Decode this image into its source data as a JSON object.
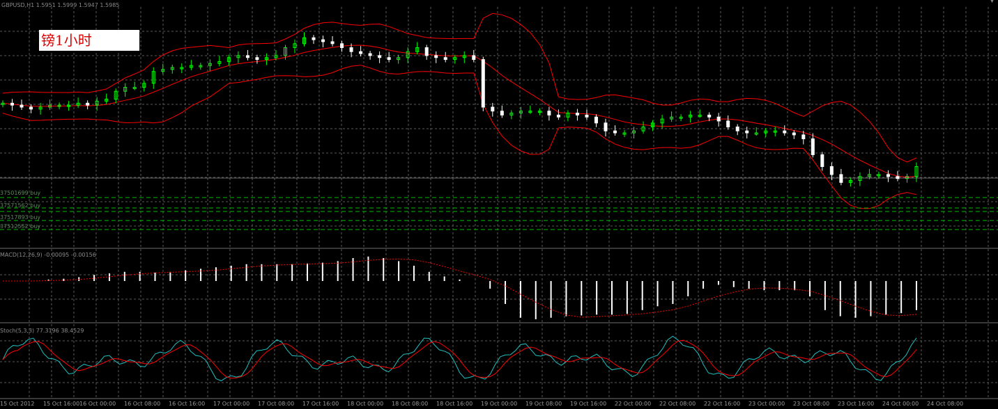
{
  "header": {
    "symbol_info": "GBPUSD,H1  1.5951 1.5999 1.5947 1.5985"
  },
  "annotation": {
    "text": "镑1小时"
  },
  "orders": [
    {
      "label": "37501699 buy"
    },
    {
      "label": "37571562 buy"
    },
    {
      "label": "37517893 buy"
    },
    {
      "label": "37512552 buy"
    }
  ],
  "indicators": {
    "macd_label": "MACD(12,26,9) -0.00095 -0.00156",
    "stoch_label": "Stoch(5,3,3) 77.3196 38.4529"
  },
  "x_axis": {
    "labels": [
      "15 Oct 2012",
      "15 Oct 16:00",
      "16 Oct 00:00",
      "16 Oct 08:00",
      "16 Oct 16:00",
      "17 Oct 00:00",
      "17 Oct 08:00",
      "17 Oct 16:00",
      "18 Oct 00:00",
      "18 Oct 08:00",
      "18 Oct 16:00",
      "19 Oct 00:00",
      "19 Oct 08:00",
      "19 Oct 16:00",
      "22 Oct 00:00",
      "22 Oct 08:00",
      "22 Oct 16:00",
      "23 Oct 00:00",
      "23 Oct 08:00",
      "23 Oct 16:00",
      "24 Oct 00:00",
      "24 Oct 08:00"
    ]
  },
  "colors": {
    "background": "#000000",
    "grid": "#5a5a5a",
    "bull_candle": "#00ff00",
    "bear_candle": "#ffffff",
    "bollinger": "#ff0000",
    "order_line": "#00c000",
    "macd_hist": "#ffffff",
    "macd_signal": "#ff0000",
    "stoch_main": "#20c0c0",
    "stoch_signal": "#ff0000",
    "annotation_text": "#e00000"
  },
  "chart_data": {
    "type": "candlestick",
    "ohlc_close_path": [
      0.62,
      0.61,
      0.6,
      0.59,
      0.6,
      0.61,
      0.61,
      0.61,
      0.62,
      0.61,
      0.63,
      0.64,
      0.68,
      0.7,
      0.7,
      0.72,
      0.78,
      0.79,
      0.8,
      0.8,
      0.81,
      0.81,
      0.82,
      0.83,
      0.85,
      0.86,
      0.85,
      0.84,
      0.85,
      0.86,
      0.9,
      0.92,
      0.95,
      0.94,
      0.93,
      0.92,
      0.9,
      0.88,
      0.87,
      0.86,
      0.85,
      0.84,
      0.85,
      0.88,
      0.9,
      0.86,
      0.85,
      0.84,
      0.85,
      0.86,
      0.84,
      0.6,
      0.58,
      0.56,
      0.57,
      0.58,
      0.58,
      0.58,
      0.56,
      0.55,
      0.57,
      0.56,
      0.55,
      0.52,
      0.48,
      0.47,
      0.47,
      0.48,
      0.5,
      0.52,
      0.54,
      0.55,
      0.55,
      0.56,
      0.56,
      0.55,
      0.53,
      0.5,
      0.48,
      0.47,
      0.47,
      0.48,
      0.48,
      0.47,
      0.46,
      0.44,
      0.36,
      0.3,
      0.26,
      0.22,
      0.23,
      0.25,
      0.26,
      0.26,
      0.25,
      0.24,
      0.25,
      0.3
    ],
    "macd_histogram_path": [
      0.0,
      0.0,
      0.0,
      0.02,
      0.03,
      0.05,
      0.08,
      0.1,
      0.12,
      0.12,
      0.11,
      0.12,
      0.14,
      0.16,
      0.18,
      0.2,
      0.22,
      0.22,
      0.22,
      0.22,
      0.23,
      0.24,
      0.26,
      0.3,
      0.32,
      0.3,
      0.26,
      0.2,
      0.12,
      0.06,
      0.02,
      0.0,
      -0.1,
      -0.3,
      -0.48,
      -0.5,
      -0.48,
      -0.46,
      -0.45,
      -0.44,
      -0.44,
      -0.43,
      -0.38,
      -0.33,
      -0.3,
      -0.2,
      -0.1,
      -0.05,
      -0.08,
      -0.1,
      -0.12,
      -0.12,
      -0.12,
      -0.2,
      -0.38,
      -0.46,
      -0.48,
      -0.46,
      -0.44,
      -0.42,
      -0.38
    ]
  }
}
